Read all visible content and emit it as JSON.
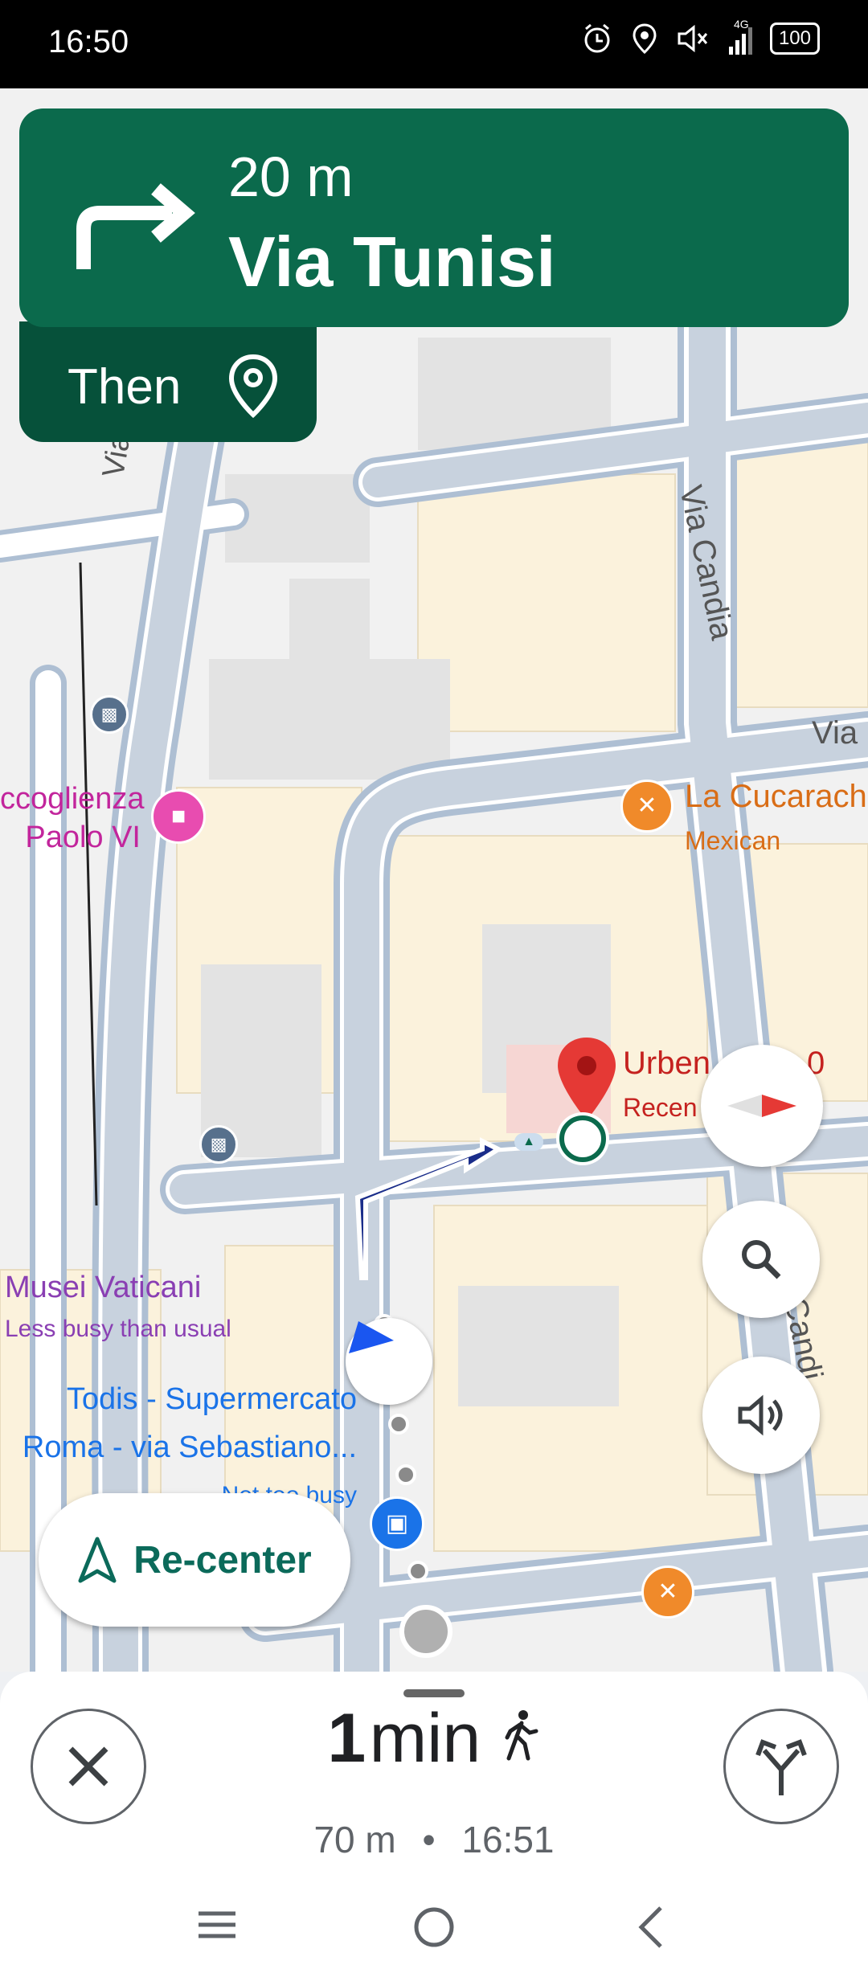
{
  "status_bar": {
    "time": "16:50",
    "network": "4G",
    "battery": "100"
  },
  "navigation": {
    "distance": "20 m",
    "street": "Via Tunisi",
    "then_label": "Then"
  },
  "map": {
    "streets": [
      "Viale Vatica",
      "Via Candia",
      "Via",
      "Candi"
    ],
    "places": [
      {
        "name": "ccoglienza",
        "name2": "Paolo VI"
      },
      {
        "name": "La Cucarach",
        "category": "Mexican"
      },
      {
        "name": "Urben",
        "suffix": "0",
        "sub": "Recen"
      },
      {
        "name": "Musei Vaticani",
        "sub": "Less busy than usual"
      },
      {
        "name": "Todis - Supermercato",
        "name2": "Roma - via Sebastiano...",
        "sub": "Not too busy"
      }
    ]
  },
  "recenter_label": "Re-center",
  "trip": {
    "duration_value": "1",
    "duration_unit": "min",
    "distance": "70 m",
    "separator": "•",
    "arrival": "16:51"
  },
  "colors": {
    "banner": "#0b6a4c",
    "then_bg": "#06513a",
    "route": "#1a2d8a"
  }
}
